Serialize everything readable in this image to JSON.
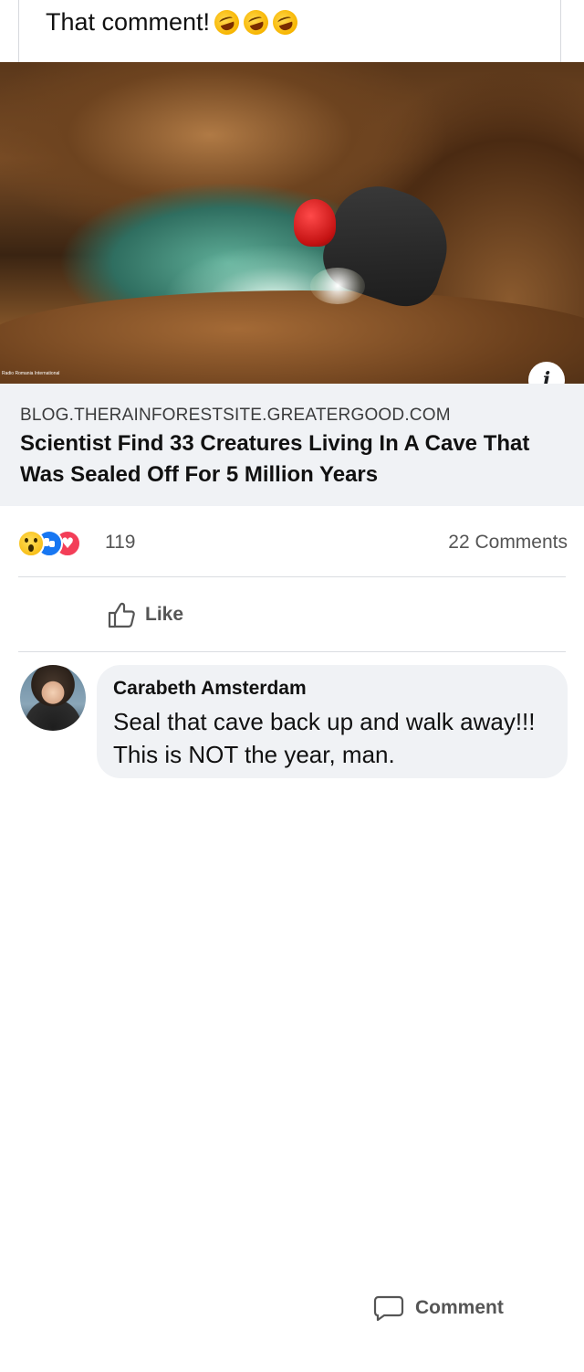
{
  "post": {
    "text": "That comment!",
    "emoji_icons": [
      "rolling-on-floor-laughing-emoji",
      "rolling-on-floor-laughing-emoji",
      "rolling-on-floor-laughing-emoji"
    ]
  },
  "hero_image": {
    "description_icon": "cave-explorer-photo",
    "watermark": "Radio Romania International",
    "info_icon": "i"
  },
  "link_preview": {
    "domain": "BLOG.THERAINFORESTSITE.GREATERGOOD.COM",
    "title": "Scientist Find 33 Creatures Living In A Cave That Was Sealed Off For 5 Million Years"
  },
  "reactions": {
    "icons": [
      "wow-reaction-icon",
      "like-reaction-icon",
      "love-reaction-icon"
    ],
    "count": "119",
    "comments": "22 Comments"
  },
  "actions": {
    "like_label": "Like",
    "comment_label": "Comment"
  },
  "comment": {
    "author": "Carabeth Amsterdam",
    "text": "Seal that cave back up and walk away!!! This is NOT the year, man."
  },
  "colors": {
    "preview_bg": "#f0f2f5",
    "like_blue": "#1877f2",
    "love_red": "#f33e58",
    "muted_text": "#555555"
  }
}
